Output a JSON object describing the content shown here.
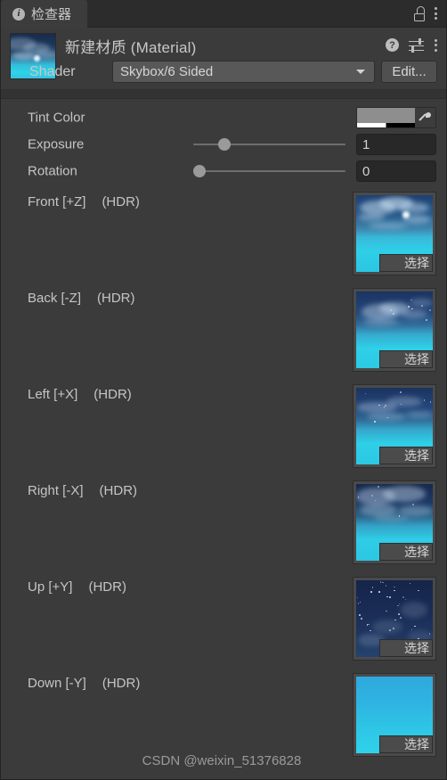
{
  "window": {
    "tab_label": "检查器",
    "tab_icon": "info-icon",
    "lock_icon": "lock-icon",
    "menu_icon": "kebab-menu-icon"
  },
  "object_header": {
    "title": "新建材质 (Material)",
    "help_icon": "help-icon",
    "preset_icon": "preset-settings-icon",
    "menu_icon": "kebab-menu-icon",
    "preview_icon": "material-preview-thumbnail"
  },
  "shader": {
    "label": "Shader",
    "value": "Skybox/6 Sided",
    "caret_icon": "chevron-down-icon",
    "edit_label": "Edit..."
  },
  "properties": [
    {
      "name": "tint-color",
      "label": "Tint Color",
      "kind": "color",
      "color": "#8e8e8e",
      "eyedropper_icon": "eyedropper-icon"
    },
    {
      "name": "exposure",
      "label": "Exposure",
      "kind": "slider",
      "value": "1",
      "knob_percent": 18
    },
    {
      "name": "rotation",
      "label": "Rotation",
      "kind": "slider",
      "value": "0",
      "knob_percent": 0
    }
  ],
  "textures": [
    {
      "name": "front-pz",
      "label": "Front [+Z]",
      "hdr": "(HDR)",
      "select_label": "选择",
      "style": "front"
    },
    {
      "name": "back-nz",
      "label": "Back [-Z]",
      "hdr": "(HDR)",
      "select_label": "选择",
      "style": "back"
    },
    {
      "name": "left-px",
      "label": "Left [+X]",
      "hdr": "(HDR)",
      "select_label": "选择",
      "style": "left"
    },
    {
      "name": "right-nx",
      "label": "Right [-X]",
      "hdr": "(HDR)",
      "select_label": "选择",
      "style": "right"
    },
    {
      "name": "up-py",
      "label": "Up [+Y]",
      "hdr": "(HDR)",
      "select_label": "选择",
      "style": "up"
    },
    {
      "name": "down-ny",
      "label": "Down [-Y]",
      "hdr": "(HDR)",
      "select_label": "选择",
      "style": "down"
    }
  ],
  "watermark": "CSDN @weixin_51376828",
  "colors": {
    "panel_bg": "#3b3b3b",
    "tabbar_bg": "#2c2c2c",
    "field_bg": "#282828",
    "dropdown_bg": "#585858",
    "text": "#c5c5c5",
    "sky_cyan": "#2fc4e4",
    "sky_deep": "#1b3358"
  }
}
